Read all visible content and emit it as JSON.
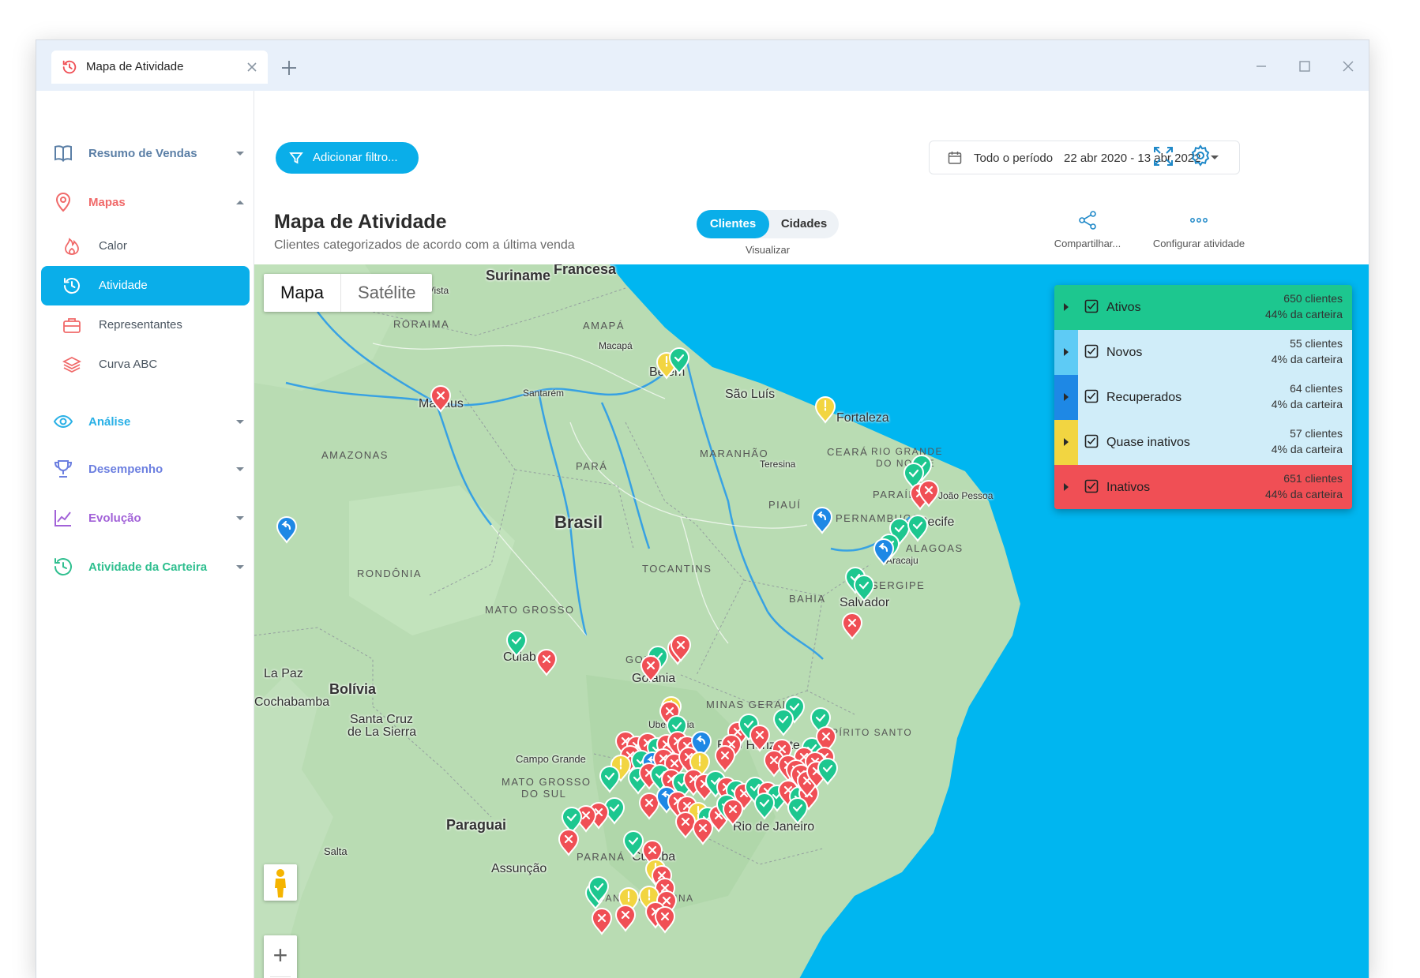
{
  "tab": {
    "title": "Mapa de Atividade"
  },
  "colors": {
    "accent": "#0aaee9",
    "ativos": "#1dc78f",
    "novos": "#5ecbf5",
    "recuperados": "#1e88e5",
    "quase_inativos": "#f2d541",
    "inativos": "#f04f55",
    "ocean": "#00b6f0"
  },
  "sidebar": {
    "groups": [
      {
        "label": "Resumo de Vendas",
        "color": "#5b7fa6",
        "icon": "book-icon"
      },
      {
        "label": "Mapas",
        "color": "#f06a6a",
        "icon": "map-pin-icon"
      },
      {
        "label": "Análise",
        "color": "#29b0e6",
        "icon": "eye-icon"
      },
      {
        "label": "Desempenho",
        "color": "#6c7fe0",
        "icon": "trophy-icon"
      },
      {
        "label": "Evolução",
        "color": "#a262d8",
        "icon": "chart-line-icon"
      },
      {
        "label": "Atividade da Carteira",
        "color": "#2fbf8f",
        "icon": "history-icon"
      }
    ],
    "map_items": [
      {
        "label": "Calor",
        "icon": "flame-icon"
      },
      {
        "label": "Atividade",
        "icon": "history-icon"
      },
      {
        "label": "Representantes",
        "icon": "briefcase-icon"
      },
      {
        "label": "Curva ABC",
        "icon": "layers-icon"
      }
    ]
  },
  "toolbar": {
    "filter_label": "Adicionar filtro...",
    "period_label": "Todo o período",
    "period_range": "22 abr 2020 - 13 abr 2022"
  },
  "page": {
    "title": "Mapa de Atividade",
    "subtitle": "Clientes categorizados de acordo com a última venda",
    "toggle": {
      "on": "Clientes",
      "off": "Cidades",
      "caption": "Visualizar"
    },
    "actions": {
      "share": "Compartilhar...",
      "configure": "Configurar atividade"
    }
  },
  "map": {
    "type_map": "Mapa",
    "type_satellite": "Satélite",
    "zoom_in": "+",
    "zoom_out": "−",
    "labels": {
      "suriname": "Suriname",
      "francesa": "Francesa",
      "boa_vista": "Boa Vista",
      "roraima": "RORAIMA",
      "amapa": "AMAPÁ",
      "macapa": "Macapá",
      "santarem": "Santarém",
      "manaus": "Manaus",
      "belem": "Belém",
      "sao_luis": "São Luís",
      "fortaleza": "Fortaleza",
      "amazonas": "AMAZONAS",
      "para": "PARÁ",
      "maranhao": "MARANHÃO",
      "teresina": "Teresina",
      "ceara": "CEARÁ",
      "rn1": "RIO GRANDE",
      "rn2": "DO NORTE",
      "paraiba": "PARAÍBA",
      "joao_pessoa": "João Pessoa",
      "piaui": "PIAUÍ",
      "pernambuco": "PERNAMBUCO",
      "recife": "Recife",
      "alagoas": "ALAGOAS",
      "aracaju": "Aracaju",
      "brasil": "Brasil",
      "tocantins": "TOCANTINS",
      "sergipe": "SERGIPE",
      "rondonia": "RONDÔNIA",
      "bahia": "BAHIA",
      "salvador": "Salvador",
      "mato_grosso": "MATO GROSSO",
      "cuiaba": "Cuiabá",
      "goias": "GOIÁS",
      "goiania": "Goiânia",
      "la_paz": "La Paz",
      "bolivia": "Bolívia",
      "cochabamba": "Cochabamba",
      "santa_cruz1": "Santa Cruz",
      "santa_cruz2": "de La Sierra",
      "minas_gerais": "MINAS GERAIS",
      "uberlandia": "Uberlândia",
      "belo_horizonte": "Belo Horizonte",
      "espirito_santo": "ESPÍRITO SANTO",
      "campo_grande": "Campo Grande",
      "ms1": "MATO GROSSO",
      "ms2": "DO SUL",
      "paraguai": "Paraguai",
      "rio": "Rio de Janeiro",
      "salta": "Salta",
      "assuncao": "Assunção",
      "parana": "PARANÁ",
      "curitiba": "Curitiba",
      "santa_catarina": "SANTA CATARINA"
    }
  },
  "legend": [
    {
      "name": "Ativos",
      "count": "650 clientes",
      "share": "44% da carteira"
    },
    {
      "name": "Novos",
      "count": "55 clientes",
      "share": "4% da carteira"
    },
    {
      "name": "Recuperados",
      "count": "64 clientes",
      "share": "4% da carteira"
    },
    {
      "name": "Quase inativos",
      "count": "57 clientes",
      "share": "4% da carteira"
    },
    {
      "name": "Inativos",
      "count": "651 clientes",
      "share": "44% da carteira"
    }
  ]
}
